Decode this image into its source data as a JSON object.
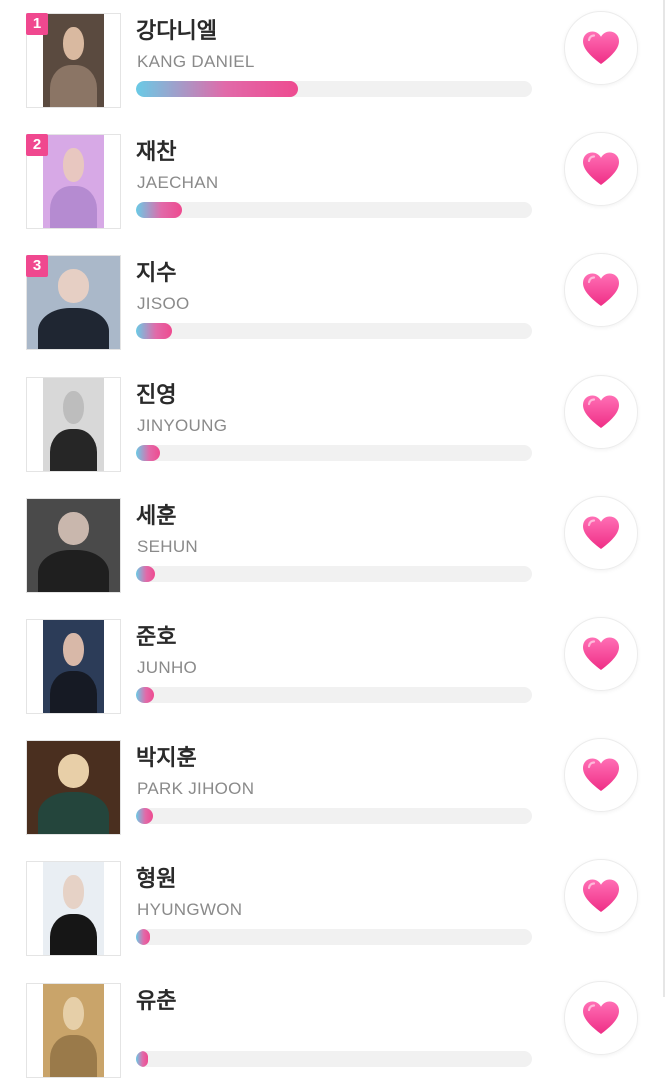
{
  "ranking": [
    {
      "rank_label": "1",
      "name_ko": "강다니엘",
      "name_en": "KANG DANIEL",
      "vote_share": 0.41,
      "photo": {
        "bg": "#5a4a3f",
        "fig": "#8b7565",
        "skin": "#d9b9a0",
        "full": false
      }
    },
    {
      "rank_label": "2",
      "name_ko": "재찬",
      "name_en": "JAECHAN",
      "vote_share": 0.115,
      "photo": {
        "bg": "#d7a9e6",
        "fig": "#b58bd1",
        "skin": "#e8c7c0",
        "full": false
      }
    },
    {
      "rank_label": "3",
      "name_ko": "지수",
      "name_en": "JISOO",
      "vote_share": 0.09,
      "photo": {
        "bg": "#aab8c9",
        "fig": "#1f2632",
        "skin": "#e6cfc4",
        "full": true
      }
    },
    {
      "rank_label": "",
      "name_ko": "진영",
      "name_en": "JINYOUNG",
      "vote_share": 0.06,
      "photo": {
        "bg": "#d8d8d8",
        "fig": "#262626",
        "skin": "#bdbdbd",
        "full": false
      }
    },
    {
      "rank_label": "",
      "name_ko": "세훈",
      "name_en": "SEHUN",
      "vote_share": 0.048,
      "photo": {
        "bg": "#4a4a4a",
        "fig": "#1f1f1f",
        "skin": "#c9b7ad",
        "full": true
      }
    },
    {
      "rank_label": "",
      "name_ko": "준호",
      "name_en": "JUNHO",
      "vote_share": 0.045,
      "photo": {
        "bg": "#2c3c58",
        "fig": "#161a24",
        "skin": "#d8b8a8",
        "full": false
      }
    },
    {
      "rank_label": "",
      "name_ko": "박지훈",
      "name_en": "PARK JIHOON",
      "vote_share": 0.042,
      "photo": {
        "bg": "#4a2f1f",
        "fig": "#24453c",
        "skin": "#e8cfa8",
        "full": true
      }
    },
    {
      "rank_label": "",
      "name_ko": "형원",
      "name_en": "HYUNGWON",
      "vote_share": 0.035,
      "photo": {
        "bg": "#e9eef3",
        "fig": "#161616",
        "skin": "#e6d2c6",
        "full": false
      }
    },
    {
      "rank_label": "",
      "name_ko": "유춘",
      "name_en": "",
      "vote_share": 0.03,
      "photo": {
        "bg": "#c9a46a",
        "fig": "#9a7a4a",
        "skin": "#e6cfa8",
        "full": false
      }
    }
  ],
  "icons": {
    "vote": "heart-icon"
  },
  "colors": {
    "accent": "#f0488f",
    "bar_start": "#69cbe6",
    "bar_end": "#ee4b90",
    "track": "#f1f1f1"
  }
}
